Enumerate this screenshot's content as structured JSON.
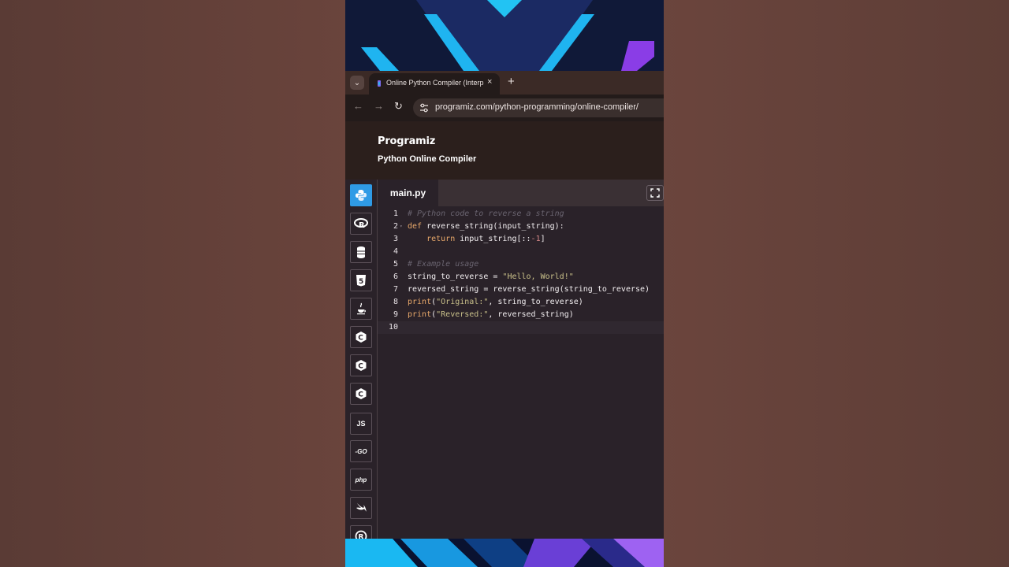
{
  "browser": {
    "tab_title": "Online Python Compiler (Interpreter)",
    "tab_close": "×",
    "new_tab": "+",
    "url": "programiz.com/python-programming/online-compiler/"
  },
  "site": {
    "logo": "Programiz",
    "subtitle": "Python Online Compiler"
  },
  "editor": {
    "file_tab": "main.py",
    "lines": [
      {
        "n": "1",
        "segments": [
          [
            "c-comment",
            "# Python code to reverse a string"
          ]
        ]
      },
      {
        "n": "2",
        "fold": true,
        "segments": [
          [
            "c-kw",
            "def"
          ],
          [
            "",
            " reverse_string(input_string):"
          ]
        ]
      },
      {
        "n": "3",
        "segments": [
          [
            "",
            "    "
          ],
          [
            "c-kw",
            "return"
          ],
          [
            "",
            " input_string[::"
          ],
          [
            "c-num",
            "-1"
          ],
          [
            "",
            "]"
          ]
        ]
      },
      {
        "n": "4",
        "segments": []
      },
      {
        "n": "5",
        "segments": [
          [
            "c-comment",
            "# Example usage"
          ]
        ]
      },
      {
        "n": "6",
        "segments": [
          [
            "",
            "string_to_reverse = "
          ],
          [
            "c-str",
            "\"Hello, World!\""
          ]
        ]
      },
      {
        "n": "7",
        "segments": [
          [
            "",
            "reversed_string = reverse_string(string_to_reverse)"
          ]
        ]
      },
      {
        "n": "8",
        "segments": [
          [
            "c-builtin",
            "print"
          ],
          [
            "",
            "("
          ],
          [
            "c-str",
            "\"Original:\""
          ],
          [
            "",
            ", string_to_reverse)"
          ]
        ]
      },
      {
        "n": "9",
        "segments": [
          [
            "c-builtin",
            "print"
          ],
          [
            "",
            "("
          ],
          [
            "c-str",
            "\"Reversed:\""
          ],
          [
            "",
            ", reversed_string)"
          ]
        ]
      },
      {
        "n": "10",
        "current": true,
        "segments": []
      }
    ]
  },
  "sidebar": {
    "languages": [
      {
        "name": "python",
        "label": "",
        "active": true
      },
      {
        "name": "r",
        "label": "R"
      },
      {
        "name": "sql",
        "label": ""
      },
      {
        "name": "html",
        "label": "5"
      },
      {
        "name": "java",
        "label": ""
      },
      {
        "name": "c",
        "label": "C"
      },
      {
        "name": "cpp",
        "label": "C"
      },
      {
        "name": "csharp",
        "label": "C"
      },
      {
        "name": "javascript",
        "label": "JS"
      },
      {
        "name": "go",
        "label": "-GO"
      },
      {
        "name": "php",
        "label": "php"
      },
      {
        "name": "swift",
        "label": ""
      },
      {
        "name": "rust",
        "label": "R"
      }
    ]
  },
  "colors": {
    "accent": "#2f9be6",
    "editor_bg": "#2a2229",
    "header_bg": "#2b1f1c"
  }
}
